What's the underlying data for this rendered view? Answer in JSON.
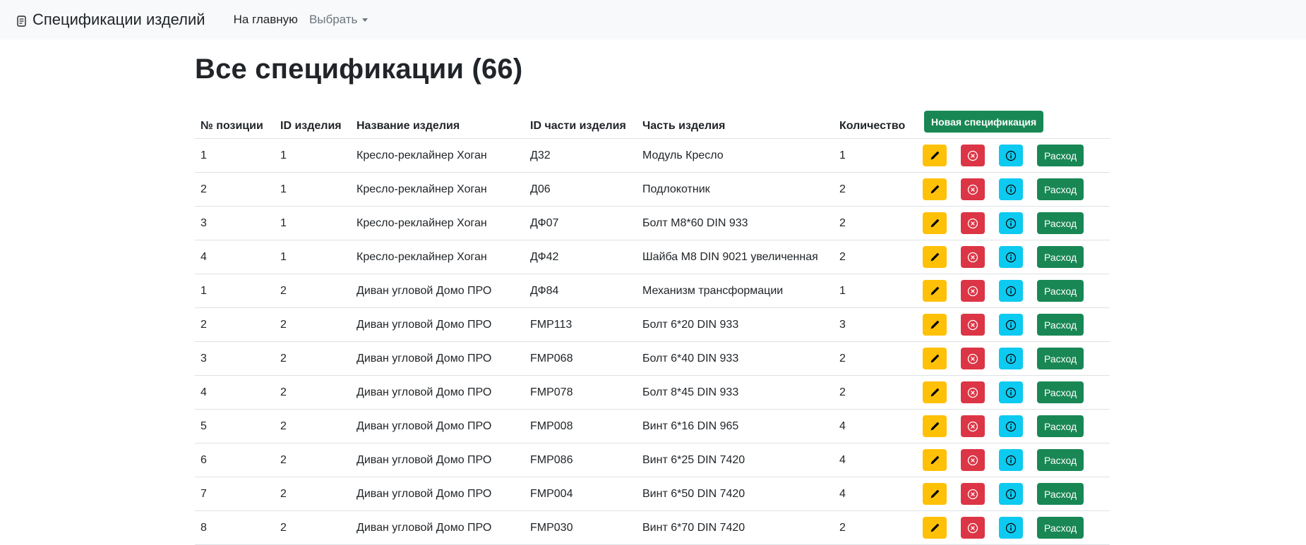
{
  "navbar": {
    "brand": "Спецификации изделий",
    "links": [
      "На главную",
      "Выбрать"
    ]
  },
  "page": {
    "title": "Все спецификации (66)"
  },
  "table": {
    "headers": [
      "№ позиции",
      "ID изделия",
      "Название изделия",
      "ID части изделия",
      "Часть изделия",
      "Количество"
    ],
    "new_button_label": "Новая спецификация",
    "consume_label": "Расход",
    "rows": [
      {
        "pos": "1",
        "id": "1",
        "name": "Кресло-реклайнер Хоган",
        "part_id": "Д32",
        "part": "Модуль Кресло",
        "qty": "1"
      },
      {
        "pos": "2",
        "id": "1",
        "name": "Кресло-реклайнер Хоган",
        "part_id": "Д06",
        "part": "Подлокотник",
        "qty": "2"
      },
      {
        "pos": "3",
        "id": "1",
        "name": "Кресло-реклайнер Хоган",
        "part_id": "ДФ07",
        "part": "Болт М8*60 DIN 933",
        "qty": "2"
      },
      {
        "pos": "4",
        "id": "1",
        "name": "Кресло-реклайнер Хоган",
        "part_id": "ДФ42",
        "part": "Шайба М8 DIN 9021 увеличенная",
        "qty": "2"
      },
      {
        "pos": "1",
        "id": "2",
        "name": "Диван угловой Домо ПРО",
        "part_id": "ДФ84",
        "part": "Механизм трансформации",
        "qty": "1"
      },
      {
        "pos": "2",
        "id": "2",
        "name": "Диван угловой Домо ПРО",
        "part_id": "FMP113",
        "part": "Болт 6*20 DIN 933",
        "qty": "3"
      },
      {
        "pos": "3",
        "id": "2",
        "name": "Диван угловой Домо ПРО",
        "part_id": "FMP068",
        "part": "Болт 6*40 DIN 933",
        "qty": "2"
      },
      {
        "pos": "4",
        "id": "2",
        "name": "Диван угловой Домо ПРО",
        "part_id": "FMP078",
        "part": "Болт 8*45 DIN 933",
        "qty": "2"
      },
      {
        "pos": "5",
        "id": "2",
        "name": "Диван угловой Домо ПРО",
        "part_id": "FMP008",
        "part": "Винт 6*16 DIN 965",
        "qty": "4"
      },
      {
        "pos": "6",
        "id": "2",
        "name": "Диван угловой Домо ПРО",
        "part_id": "FMP086",
        "part": "Винт 6*25 DIN 7420",
        "qty": "4"
      },
      {
        "pos": "7",
        "id": "2",
        "name": "Диван угловой Домо ПРО",
        "part_id": "FMP004",
        "part": "Винт 6*50 DIN 7420",
        "qty": "4"
      },
      {
        "pos": "8",
        "id": "2",
        "name": "Диван угловой Домо ПРО",
        "part_id": "FMP030",
        "part": "Винт 6*70 DIN 7420",
        "qty": "2"
      }
    ]
  },
  "icons": {
    "brand": "document-icon",
    "edit": "pencil-icon",
    "delete": "x-circle-icon",
    "info": "info-circle-icon"
  },
  "colors": {
    "warning": "#ffc107",
    "danger": "#dc3545",
    "info": "#0dcaf0",
    "success": "#198754",
    "navbar_bg": "#f8f9fa"
  }
}
